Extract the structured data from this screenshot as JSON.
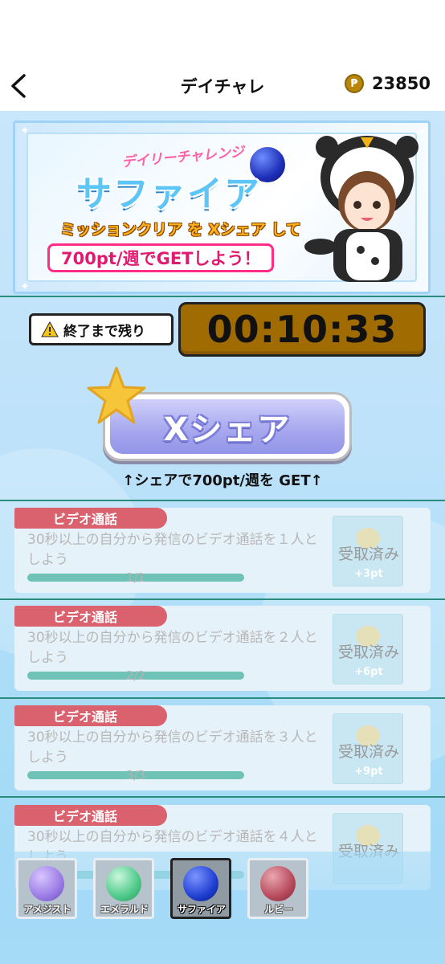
{
  "header": {
    "title": "デイチャレ",
    "coin_symbol": "₱",
    "coins": "23850"
  },
  "banner": {
    "subtitle": "デイリーチャレンジ",
    "title": "サファイア",
    "line1": "ミッションクリア を Xシェア して",
    "line2": "700pt/週でGETしよう！"
  },
  "timer": {
    "label": "終了まで残り",
    "value": "00:10:33"
  },
  "share": {
    "button_label": "Xシェア",
    "note": "↑シェアで700pt/週を GET↑"
  },
  "missions": [
    {
      "tag": "ビデオ通話",
      "desc": "30秒以上の自分から発信のビデオ通話を１人としよう",
      "progress": "1/1",
      "progress_fraction": 1.0,
      "claim_label": "受取済み",
      "points": "+3pt"
    },
    {
      "tag": "ビデオ通話",
      "desc": "30秒以上の自分から発信のビデオ通話を２人としよう",
      "progress": "2/2",
      "progress_fraction": 1.0,
      "claim_label": "受取済み",
      "points": "+6pt"
    },
    {
      "tag": "ビデオ通話",
      "desc": "30秒以上の自分から発信のビデオ通話を３人としよう",
      "progress": "3/3",
      "progress_fraction": 1.0,
      "claim_label": "受取済み",
      "points": "+9pt"
    },
    {
      "tag": "ビデオ通話",
      "desc": "30秒以上の自分から発信のビデオ通話を４人としよう",
      "progress": "",
      "progress_fraction": 1.0,
      "claim_label": "受取済み",
      "points": ""
    }
  ],
  "tabs": [
    {
      "label": "アメジスト",
      "gem_color": "#9b7be6",
      "active": false
    },
    {
      "label": "エメラルド",
      "gem_color": "#4fc98a",
      "active": false
    },
    {
      "label": "サファイア",
      "gem_color": "#1f3fd1",
      "active": true
    },
    {
      "label": "ルビー",
      "gem_color": "#b84a5c",
      "active": false
    }
  ],
  "colors": {
    "accent_teal": "#2a8c7d",
    "tag_red": "#d9626e",
    "timer_gold": "#a06b00",
    "share_lavender": "#a8a9ef"
  }
}
